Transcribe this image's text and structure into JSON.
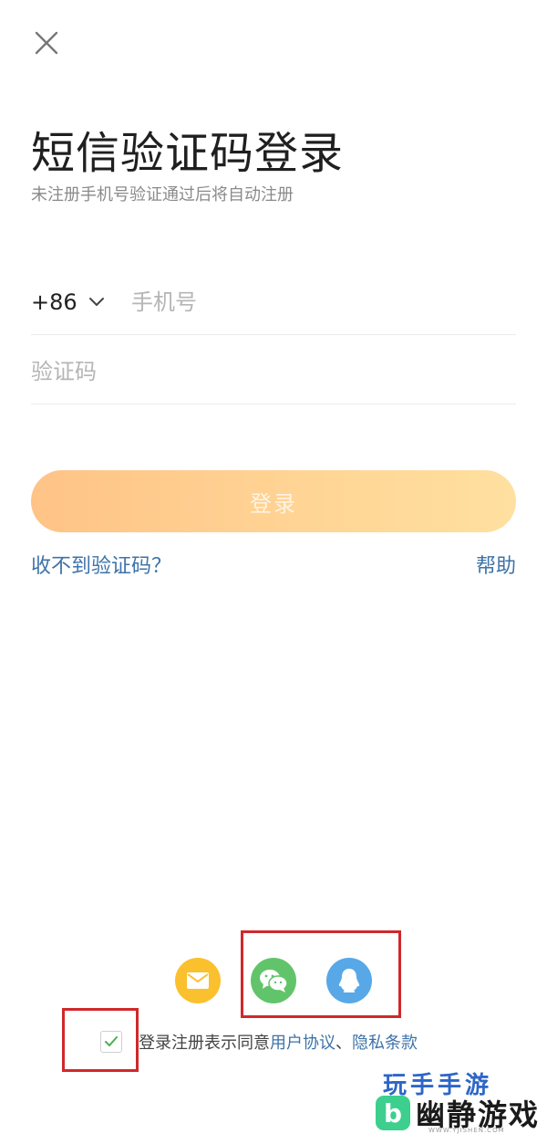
{
  "header": {
    "close_icon": "close-icon",
    "title": "短信验证码登录",
    "subtitle": "未注册手机号验证通过后将自动注册"
  },
  "form": {
    "country_code": "+86",
    "phone_placeholder": "手机号",
    "code_placeholder": "验证码",
    "login_label": "登录",
    "login_gradient": [
      "#ffc387",
      "#ffe0a0"
    ]
  },
  "links": {
    "no_code": "收不到验证码？",
    "help": "帮助",
    "color": "#3e73a8"
  },
  "social": [
    {
      "id": "email",
      "icon": "email-icon",
      "color": "#fbc02d"
    },
    {
      "id": "wechat",
      "icon": "wechat-icon",
      "color": "#62c46a"
    },
    {
      "id": "qq",
      "icon": "qq-icon",
      "color": "#58a8e8"
    }
  ],
  "agreement": {
    "checked": true,
    "prefix": "登录注册表示同意",
    "user_agreement": "用户协议",
    "separator": "、",
    "privacy": "隐私条款"
  },
  "watermark": {
    "top_text": "玩手手游",
    "logo_char": "b",
    "name": "幽静游戏",
    "url": "WWW.YJISHEN.COM"
  },
  "annotation_color": "#d0282a"
}
